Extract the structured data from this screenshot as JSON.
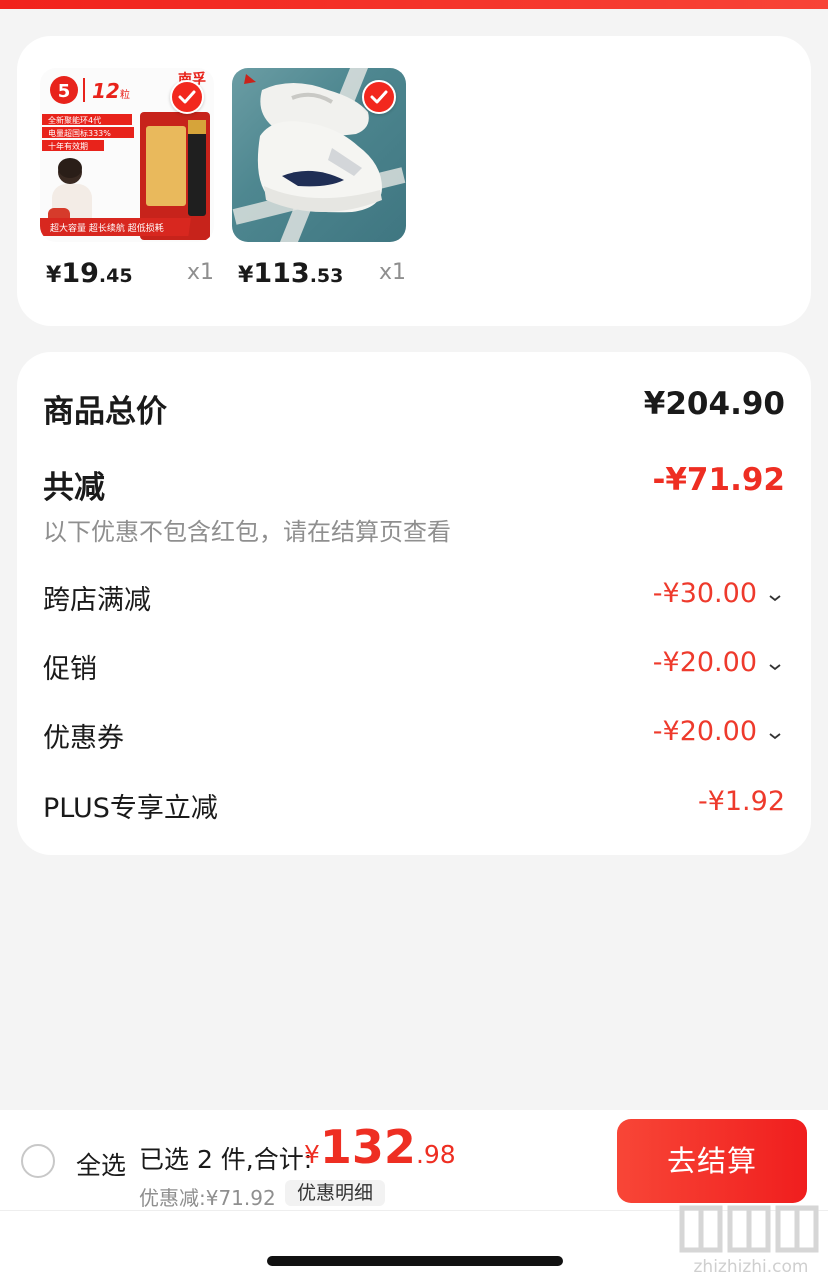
{
  "colors": {
    "accent": "#f2281e",
    "price_red": "#ee2e22",
    "muted": "#8f8f8f"
  },
  "products": [
    {
      "image_icon": "battery-product-image",
      "image_text": {
        "badge_num": "5",
        "badge_count": "12",
        "badge_unit": "粒",
        "brand": "南孚",
        "features": [
          "全新聚能环4代",
          "电量超国标333%",
          "十年有效期"
        ],
        "banner": "超大容量 超长续航 超低损耗"
      },
      "price": {
        "currency": "¥",
        "integer": "19",
        "decimal": ".45"
      },
      "qty": "x1",
      "checked": true
    },
    {
      "image_icon": "sneaker-product-image",
      "price": {
        "currency": "¥",
        "integer": "113",
        "decimal": ".53"
      },
      "qty": "x1",
      "checked": true
    }
  ],
  "summary": {
    "total_label": "商品总价",
    "total_value": "¥204.90",
    "reduce_label": "共减",
    "reduce_value": "-¥71.92",
    "note": "以下优惠不包含红包，请在结算页查看",
    "items": [
      {
        "label": "跨店满减",
        "value": "-¥30.00",
        "expandable": true
      },
      {
        "label": "促销",
        "value": "-¥20.00",
        "expandable": true
      },
      {
        "label": "优惠券",
        "value": "-¥20.00",
        "expandable": true
      },
      {
        "label": "PLUS专享立减",
        "value": "-¥1.92",
        "expandable": false
      }
    ]
  },
  "bottom": {
    "select_all": "全选",
    "selected_prefix": "已选 2 件,合计:",
    "total": {
      "currency": "¥",
      "integer": "132",
      "decimal": ".98"
    },
    "discount": "优惠减:¥71.92",
    "detail_label": "优惠明细",
    "checkout_label": "去结算"
  },
  "watermark": {
    "text": "zhizhizhi.com",
    "icon": "zhi-watermark-icon"
  }
}
